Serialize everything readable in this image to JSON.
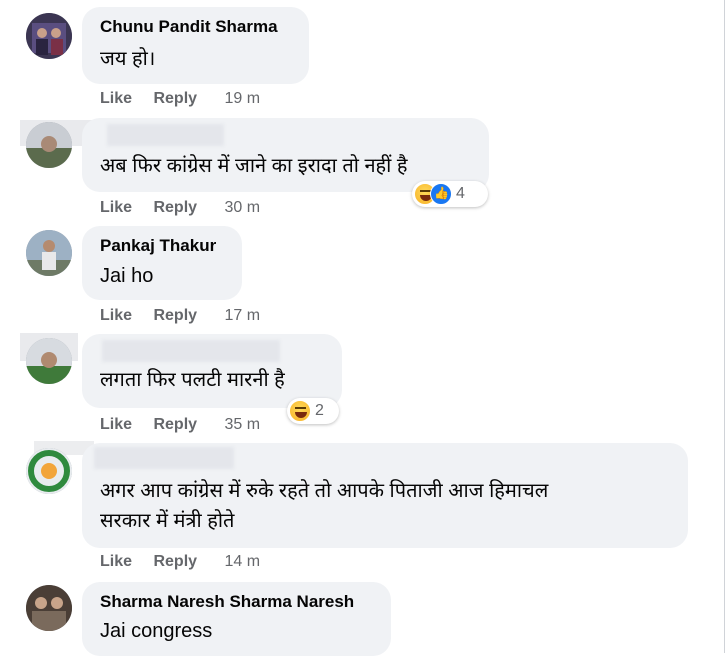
{
  "comments": [
    {
      "author": "Chunu Pandit Sharma",
      "text": "जय हो।",
      "actions": {
        "like": "Like",
        "reply": "Reply",
        "time": "19 m"
      }
    },
    {
      "author": "",
      "text": "अब फिर कांग्रेस में जाने का इरादा तो नहीं है",
      "actions": {
        "like": "Like",
        "reply": "Reply",
        "time": "30 m"
      },
      "reactions": {
        "icons": [
          "haha-icon",
          "like-icon"
        ],
        "count": "4"
      }
    },
    {
      "author": "Pankaj Thakur",
      "text": "Jai ho",
      "actions": {
        "like": "Like",
        "reply": "Reply",
        "time": "17 m"
      }
    },
    {
      "author": "",
      "text": "लगता फिर पलटी मारनी है",
      "actions": {
        "like": "Like",
        "reply": "Reply",
        "time": "35 m"
      },
      "reactions": {
        "icons": [
          "haha-icon"
        ],
        "count": "2"
      }
    },
    {
      "author": "",
      "text_lines": [
        "अगर आप कांग्रेस में रुके रहते तो आपके पिताजी आज हिमाचल",
        "सरकार में मंत्री होते"
      ],
      "actions": {
        "like": "Like",
        "reply": "Reply",
        "time": "14 m"
      }
    },
    {
      "author": "Sharma Naresh Sharma Naresh",
      "text": "Jai congress"
    }
  ],
  "colors": {
    "bubble": "#f0f2f5",
    "action_text": "#65676b",
    "like_blue": "#1877f2",
    "haha_yellow": "#f7b125"
  }
}
